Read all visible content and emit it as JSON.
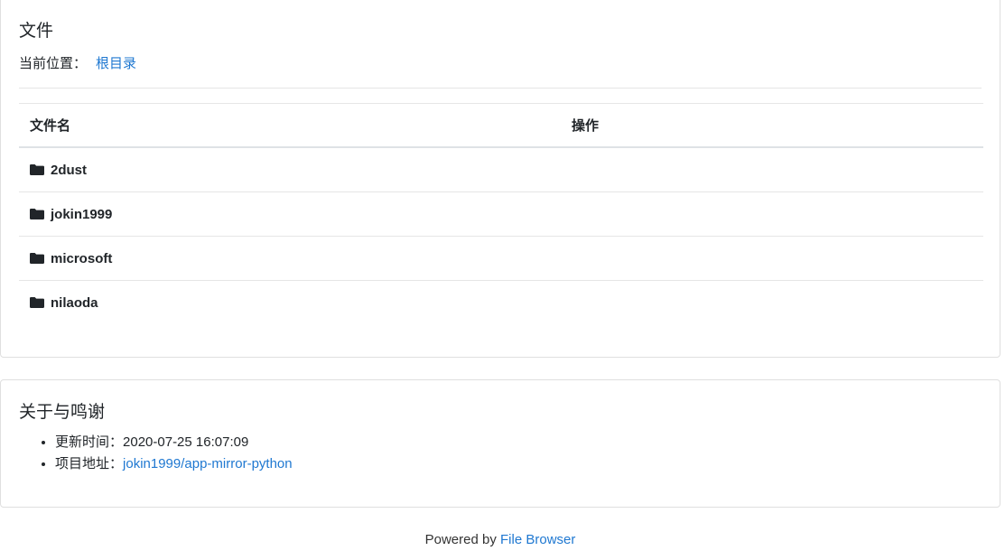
{
  "files": {
    "title": "文件",
    "breadcrumb": {
      "label": "当前位置：",
      "root": "根目录"
    },
    "table": {
      "headers": [
        "文件名",
        "操作"
      ],
      "rows": [
        {
          "name": "2dust",
          "icon": "folder-icon"
        },
        {
          "name": "jokin1999",
          "icon": "folder-icon"
        },
        {
          "name": "microsoft",
          "icon": "folder-icon"
        },
        {
          "name": "nilaoda",
          "icon": "folder-icon"
        }
      ]
    }
  },
  "about": {
    "title": "关于与鸣谢",
    "items": [
      {
        "label": "更新时间：",
        "value": "2020-07-25 16:07:09"
      },
      {
        "label": "项目地址：",
        "value": "jokin1999/app-mirror-python"
      }
    ]
  },
  "footer": {
    "prefix": "Powered by",
    "link": "File Browser"
  },
  "colors": {
    "link": "#1f78d1",
    "text": "#212529",
    "border": "#dfdfdf"
  }
}
